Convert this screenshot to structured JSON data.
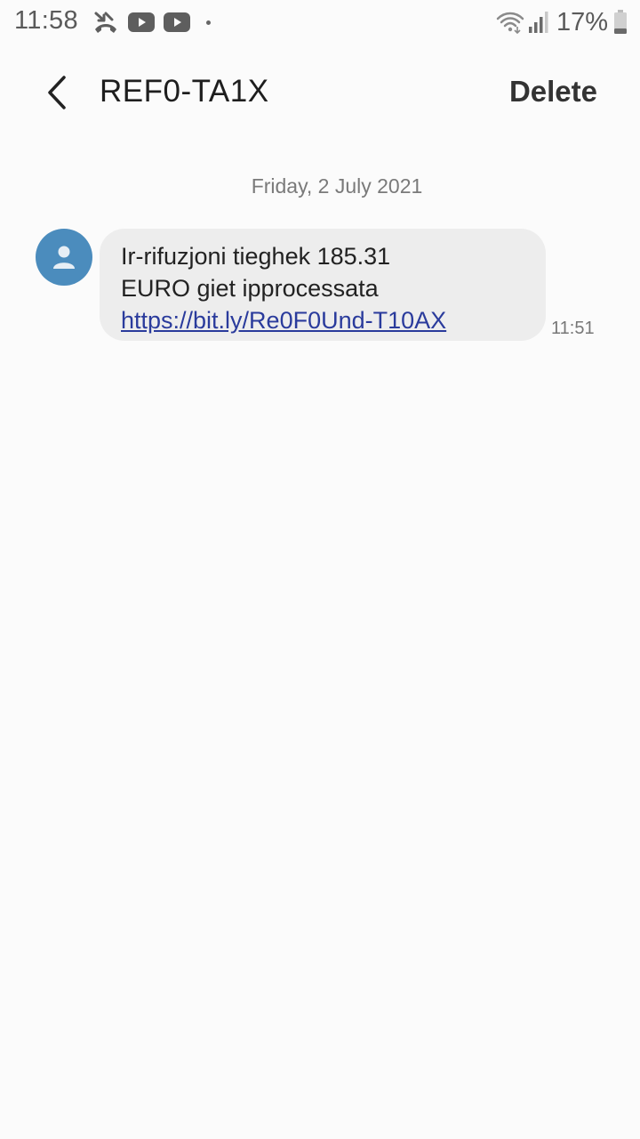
{
  "status_bar": {
    "time": "11:58",
    "left_icons": [
      "missed-call-icon",
      "youtube-icon",
      "youtube-icon",
      "dot-icon"
    ],
    "right_icons": [
      "wifi-icon",
      "signal-icon",
      "battery-icon"
    ],
    "battery_percent": "17%"
  },
  "header": {
    "back_icon": "chevron-left-icon",
    "contact_name": "REF0-TA1X",
    "delete_label": "Delete"
  },
  "conversation": {
    "date_label": "Friday, 2 July 2021",
    "messages": [
      {
        "avatar_icon": "person-icon",
        "avatar_color": "#4b8cbd",
        "line1": "Ir-rifuzjoni tieghek 185.31",
        "line2": "EURO giet ipprocessata",
        "link": "https://bit.ly/Re0F0Und-T10AX",
        "time": "11:51"
      }
    ]
  },
  "colors": {
    "background": "#fbfbfb",
    "bubble": "#ededed",
    "link": "#2a3b9c",
    "avatar": "#4b8cbd"
  }
}
